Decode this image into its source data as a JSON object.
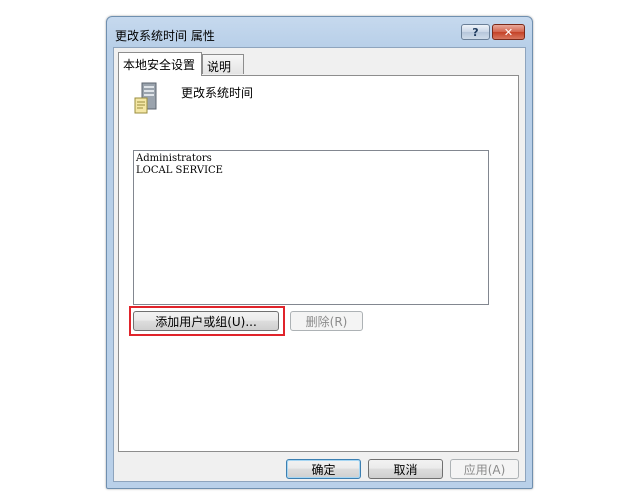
{
  "window": {
    "title": "更改系统时间 属性",
    "help_label": "?",
    "close_label": "✕"
  },
  "tabs": [
    {
      "label": "本地安全设置",
      "active": true
    },
    {
      "label": "说明",
      "active": false
    }
  ],
  "policy": {
    "name": "更改系统时间",
    "icon": "server-icon"
  },
  "principals": [
    "Administrators",
    "LOCAL SERVICE"
  ],
  "buttons": {
    "add": "添加用户或组(U)...",
    "remove": "删除(R)",
    "ok": "确定",
    "cancel": "取消",
    "apply": "应用(A)"
  },
  "colors": {
    "highlight": "#e0242b",
    "title_bar": "#b9d0e9"
  }
}
